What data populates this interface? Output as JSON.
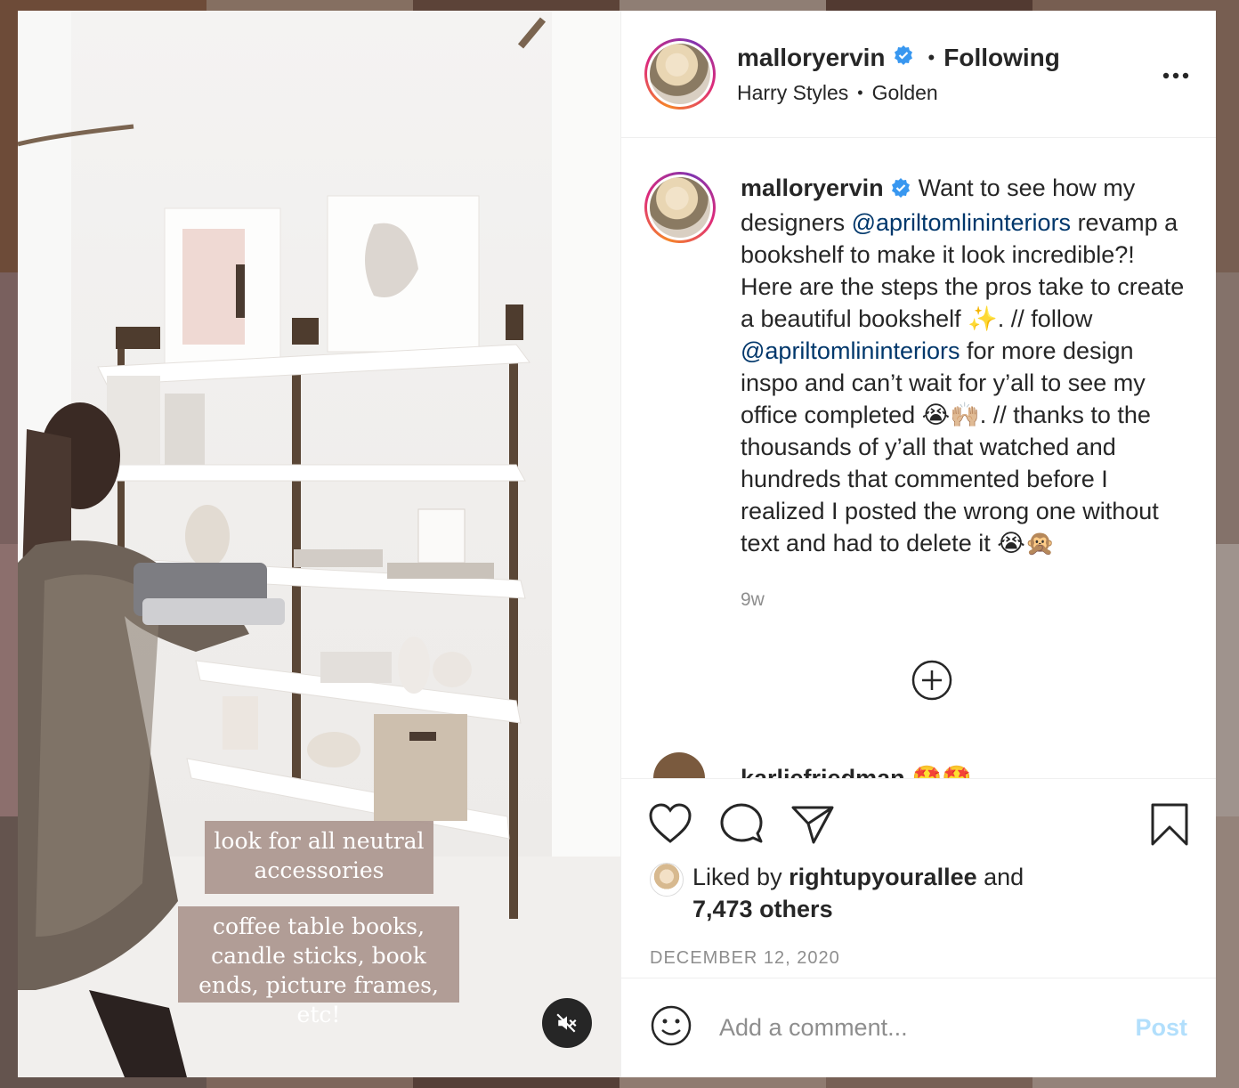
{
  "post": {
    "media": {
      "overlay_text_1": "look for all neutral accessories",
      "overlay_text_2": "coffee table books, candle sticks, book ends, picture frames, etc!",
      "mute_icon": "speaker-muted-icon"
    },
    "header": {
      "username": "malloryervin",
      "follow_status": "Following",
      "song": "Harry Styles",
      "song_title": "Golden",
      "separator": "•",
      "more_icon": "more-horizontal-icon"
    },
    "caption": {
      "username": "malloryervin",
      "text_1": "Want to see how my designers ",
      "mention_1": "@apriltomlininteriors",
      "text_2": " revamp a bookshelf to make it look incredible?! Here are the steps the pros take to create a beautiful bookshelf ✨. // follow ",
      "mention_2": "@apriltomlininteriors",
      "text_3": " for more design inspo and can’t wait for y’all to see my office completed 😭🙌🏼. // thanks to the thousands of y’all that watched and hundreds that commented before I realized I posted the wrong one without text and had to delete it 😭🙊",
      "age": "9w"
    },
    "next_comment": {
      "username": "karliefriedman",
      "emoji": "🤩🤩"
    },
    "likes": {
      "prefix": "Liked by ",
      "user": "rightupyourallee",
      "middle": " and",
      "count": "7,473 others"
    },
    "date": "DECEMBER 12, 2020",
    "comment_input": {
      "placeholder": "Add a comment...",
      "post_label": "Post"
    }
  },
  "colors": {
    "mention": "#00376b",
    "verified": "#3897f0",
    "post_disabled": "#b2dffc",
    "overlay_bg": "#ab968e"
  }
}
